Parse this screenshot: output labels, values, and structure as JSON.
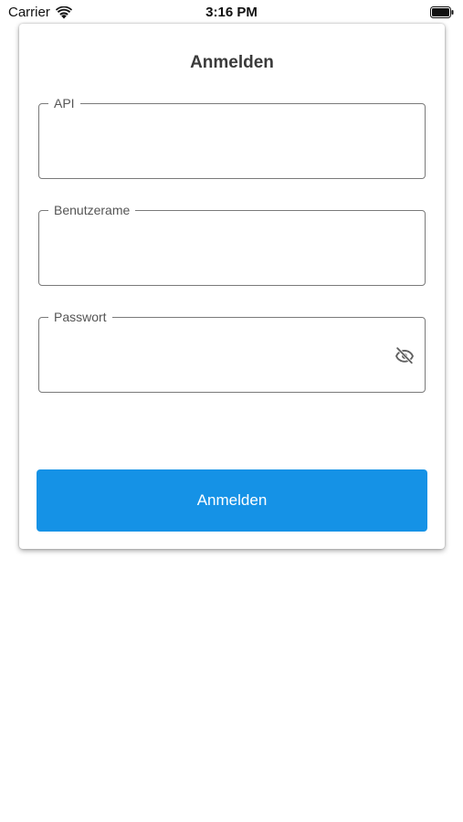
{
  "status_bar": {
    "carrier": "Carrier",
    "time": "3:16 PM",
    "icons": [
      "wifi-icon",
      "battery-icon"
    ]
  },
  "login": {
    "title": "Anmelden",
    "fields": [
      {
        "label": "API",
        "value": ""
      },
      {
        "label": "Benutzerame",
        "value": ""
      },
      {
        "label": "Passwort",
        "value": "",
        "trailing_icon": "eye-off-icon"
      }
    ],
    "submit_label": "Anmelden"
  },
  "colors": {
    "primary": "#1592e6",
    "field_border": "#7a7a7a",
    "title_text": "#3a3a3a"
  }
}
